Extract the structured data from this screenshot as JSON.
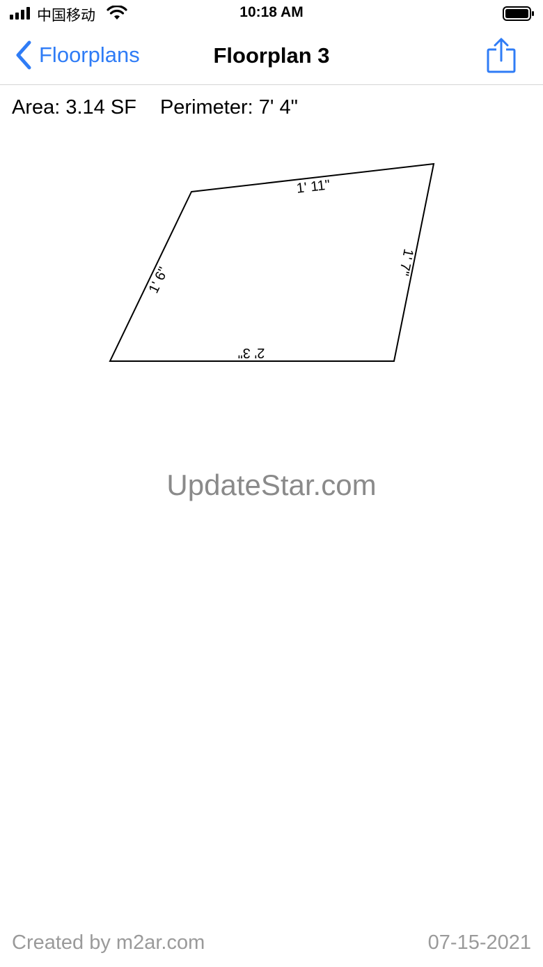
{
  "status_bar": {
    "carrier": "中国移动",
    "time": "10:18 AM"
  },
  "nav": {
    "back_label": "Floorplans",
    "title": "Floorplan 3",
    "back_icon": "chevron-left-icon",
    "share_icon": "share-icon"
  },
  "stats": {
    "area": "Area: 3.14 SF",
    "perimeter": "Perimeter: 7' 4\""
  },
  "floorplan": {
    "edges": {
      "top": "1' 11\"",
      "left": "1' 6\"",
      "right": "1' 7\"",
      "bottom": "2' 3\""
    }
  },
  "watermark": "UpdateStar.com",
  "footer": {
    "created_by": "Created by m2ar.com",
    "date": "07-15-2021"
  },
  "colors": {
    "accent": "#2f7cf6",
    "muted": "#9a9a9a"
  }
}
